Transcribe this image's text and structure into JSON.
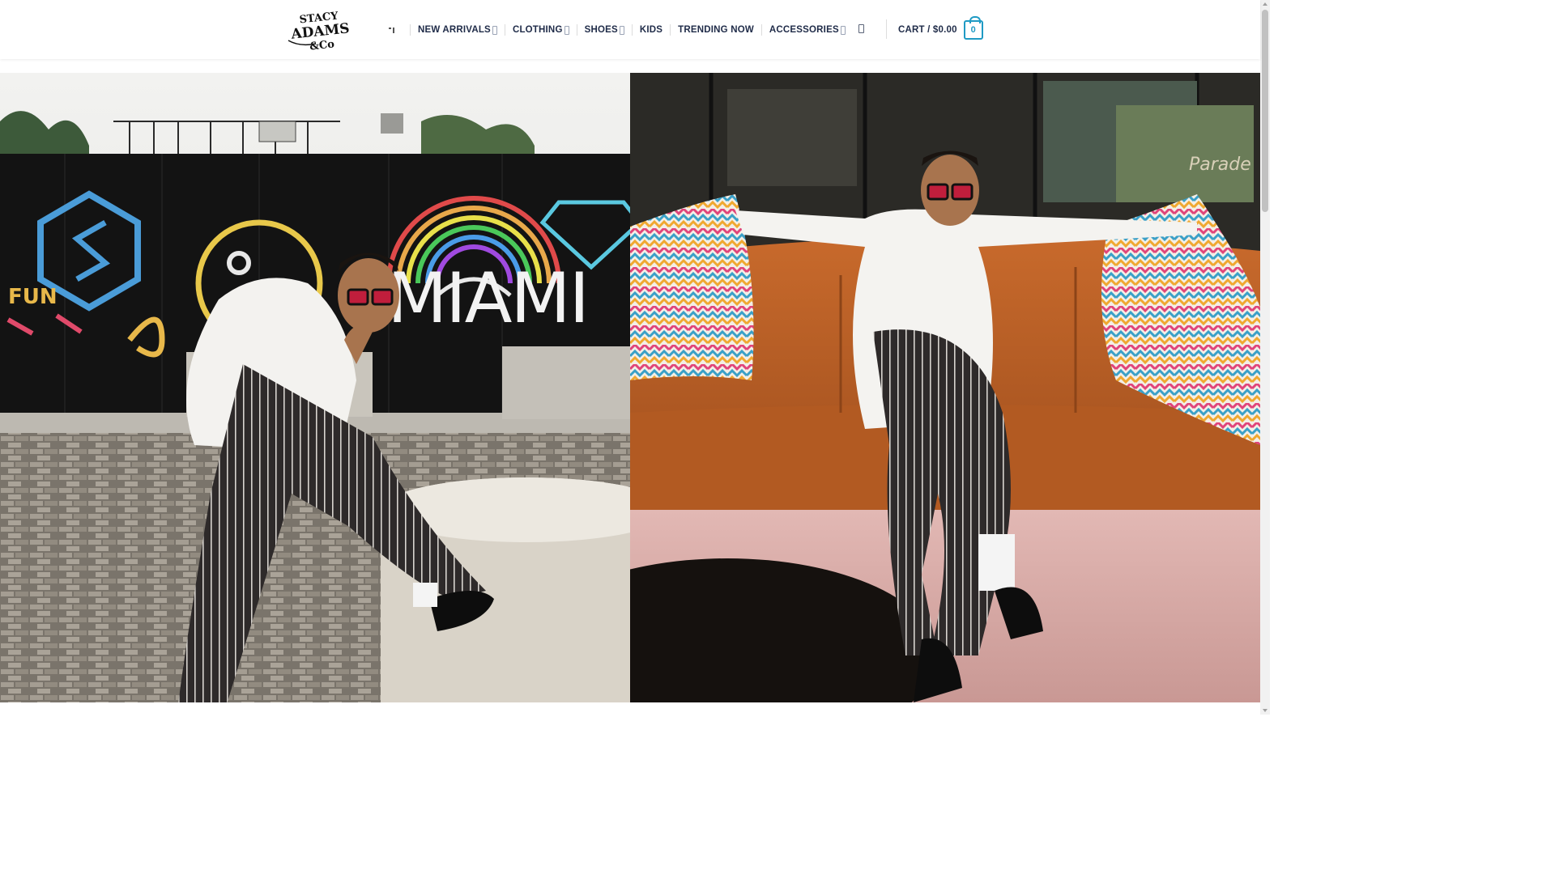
{
  "brand": {
    "logo_lines": [
      "STACY",
      "ADAMS",
      "&Co"
    ]
  },
  "nav": {
    "menu_icon": "menu-icon",
    "items": [
      {
        "label": "NEW ARRIVALS",
        "has_dropdown": true
      },
      {
        "label": "CLOTHING",
        "has_dropdown": true
      },
      {
        "label": "SHOES",
        "has_dropdown": true
      },
      {
        "label": "KIDS",
        "has_dropdown": false
      },
      {
        "label": "TRENDING NOW",
        "has_dropdown": false
      },
      {
        "label": "ACCESSORIES",
        "has_dropdown": true
      }
    ]
  },
  "header": {
    "search_icon": "search-icon",
    "cart_label": "CART / $0.00",
    "cart_count": "0"
  },
  "hero": {
    "left_image_text": [
      "FUN",
      "MIAMI"
    ],
    "right_image_text": "Parade"
  },
  "colors": {
    "nav_text": "#1f2b48",
    "accent": "#1f9ac4",
    "divider": "#dcdcdc"
  }
}
